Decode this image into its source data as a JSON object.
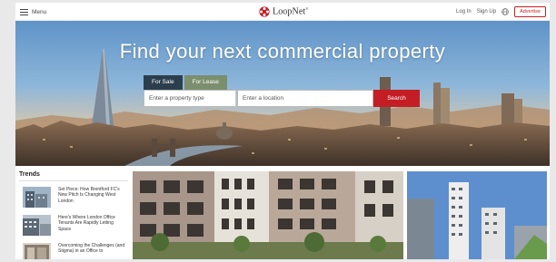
{
  "header": {
    "menu_label": "Menu",
    "brand": "LoopNet",
    "brand_mark": "®",
    "login_label": "Log In",
    "signup_label": "Sign Up",
    "globe_icon": "globe-icon",
    "advertise_label": "Advertise"
  },
  "hero": {
    "title": "Find your next commercial property",
    "tabs": [
      {
        "label": "For Sale",
        "active": true
      },
      {
        "label": "For Lease",
        "active": false
      }
    ],
    "search": {
      "type_placeholder": "Enter a property type",
      "location_placeholder": "Enter a location",
      "button_label": "Search"
    }
  },
  "trends": {
    "title": "Trends",
    "items": [
      {
        "text": "Set Piece: How Brentford FC's New Pitch Is Changing West London"
      },
      {
        "text": "Here's Where London Office Tenants Are Rapidly Letting Space"
      },
      {
        "text": "Overcoming the Challenges (and Stigma) in an Office to"
      }
    ]
  },
  "colors": {
    "brand_red": "#c41e25",
    "tab_active": "#2c3e4e",
    "tab_inactive": "#7b8f6e"
  }
}
